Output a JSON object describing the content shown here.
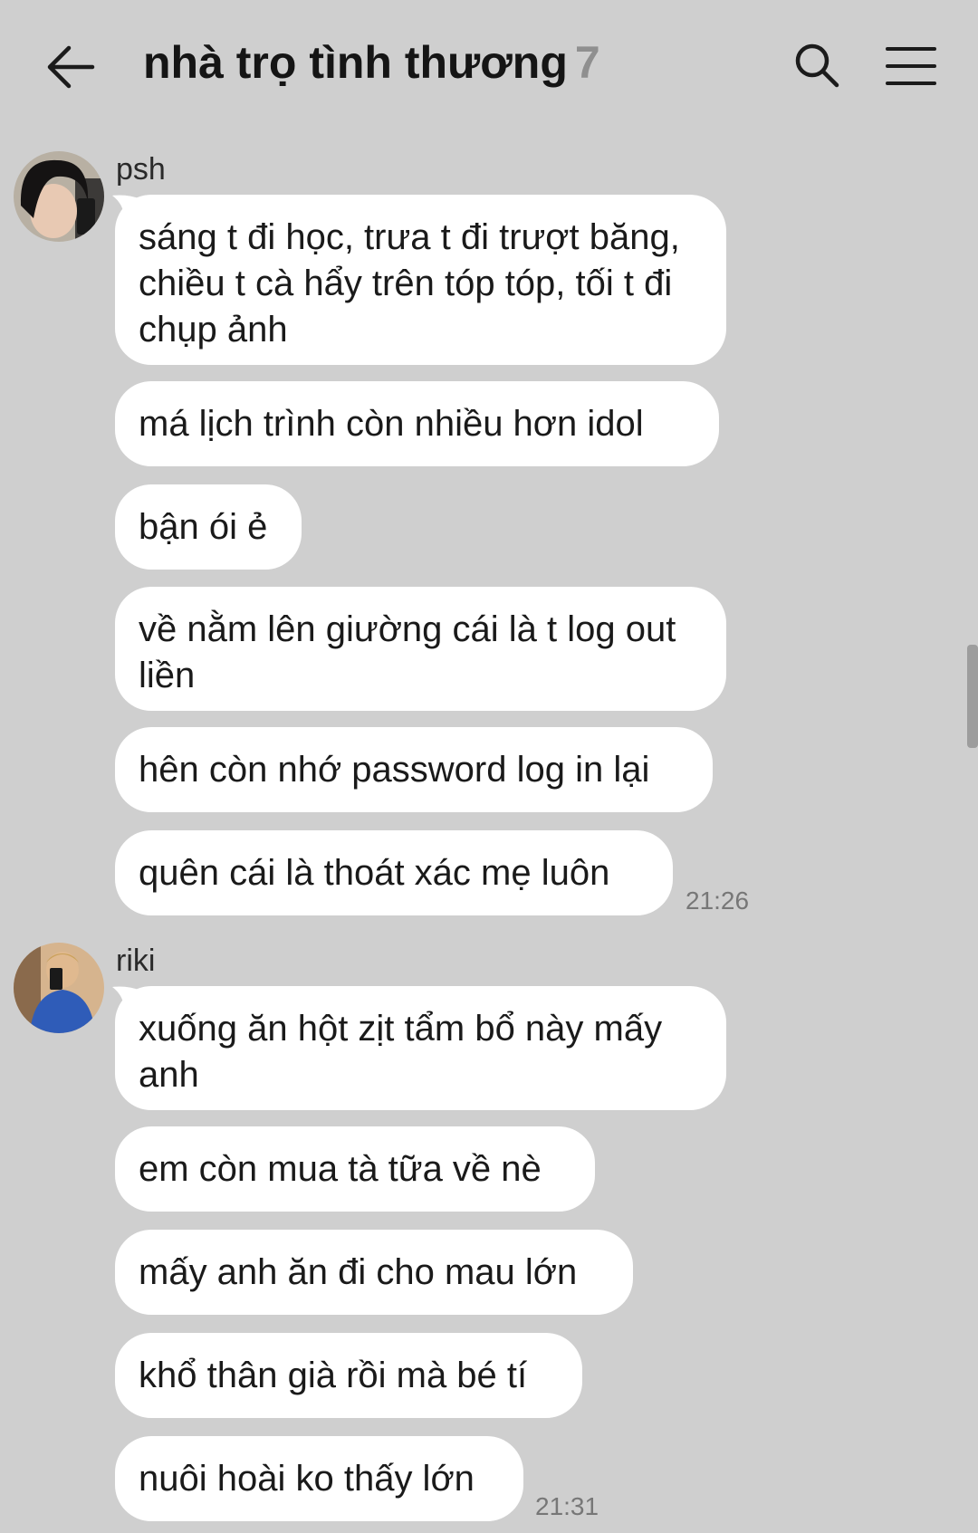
{
  "header": {
    "title": "nhà trọ tình thương",
    "member_count": "7",
    "back_icon": "arrow-left-icon",
    "search_icon": "search-icon",
    "menu_icon": "menu-icon"
  },
  "colors": {
    "background": "#cfcfcf",
    "bubble": "#ffffff",
    "member_count": "#8f8f8f"
  },
  "groups": [
    {
      "sender": "psh",
      "time": "21:26",
      "messages": [
        "sáng t đi học, trưa t đi trượt băng, chiều t cà hẩy trên tóp tóp, tối t đi chụp ảnh",
        "má lịch trình còn nhiều hơn idol",
        "bận ói ẻ",
        "về nằm lên giường cái là t log out liền",
        "hên còn nhớ password log in lại",
        "quên cái là thoát xác mẹ luôn"
      ]
    },
    {
      "sender": "riki",
      "time": "21:31",
      "messages": [
        "xuống ăn hột zịt tẩm bổ này mấy anh",
        "em còn mua tà tữa về nè",
        "mấy anh ăn đi cho mau lớn",
        "khổ thân già rồi mà bé tí",
        "nuôi hoài ko thấy lớn"
      ]
    }
  ]
}
